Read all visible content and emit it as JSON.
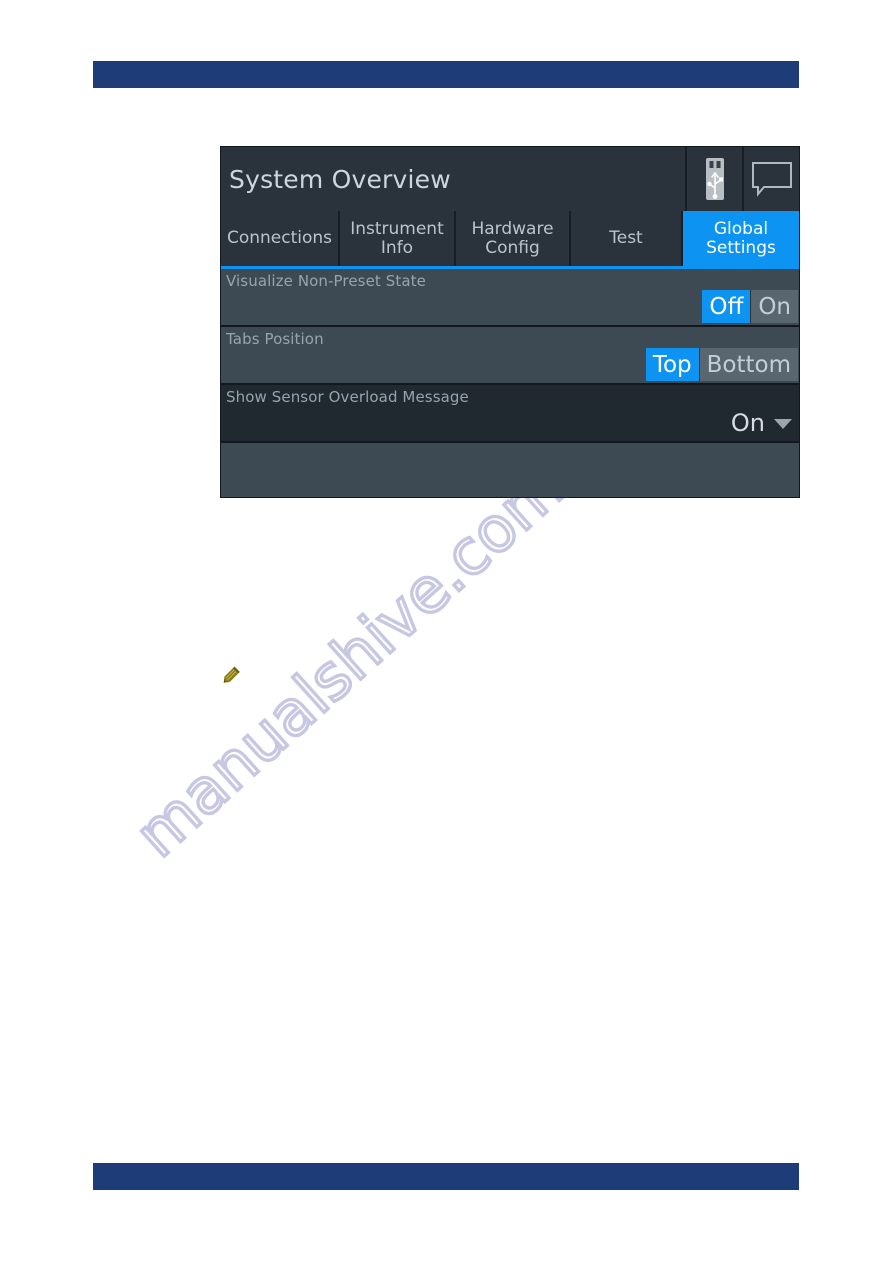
{
  "page": {
    "top_bar_color": "#1e3c78",
    "bottom_bar_color": "#1e3c78",
    "watermark_text": "manualshive.com"
  },
  "panel": {
    "accent_color": "#0d94f2",
    "header": {
      "title": "System Overview",
      "icons": [
        {
          "name": "usb-stick-icon",
          "label": "USB"
        },
        {
          "name": "message-bubble-icon",
          "label": "Messages"
        }
      ]
    },
    "tabs": [
      {
        "label": "Connections",
        "active": false
      },
      {
        "label": "Instrument Info",
        "active": false
      },
      {
        "label": "Hardware Config",
        "active": false
      },
      {
        "label": "Test",
        "active": false
      },
      {
        "label": "Global Settings",
        "active": true
      }
    ],
    "settings": [
      {
        "label": "Visualize Non-Preset State",
        "type": "segmented",
        "options": [
          "Off",
          "On"
        ],
        "selected": "Off"
      },
      {
        "label": "Tabs Position",
        "type": "segmented",
        "options": [
          "Top",
          "Bottom"
        ],
        "selected": "Top"
      },
      {
        "label": "Show Sensor Overload Message",
        "type": "dropdown",
        "value": "On"
      }
    ]
  },
  "note": {
    "icon": "pencil-note-icon",
    "icon_color": "#8a7b14"
  }
}
